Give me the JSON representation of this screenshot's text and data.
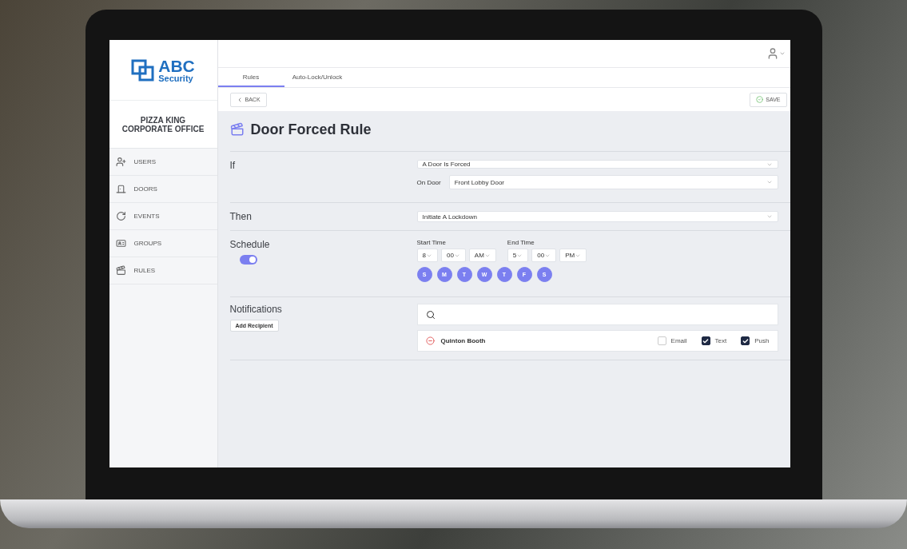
{
  "sidebar": {
    "logo": {
      "name": "ABC",
      "tagline": "Security"
    },
    "organization": "PIZZA KING CORPORATE OFFICE",
    "nav": [
      {
        "label": "USERS"
      },
      {
        "label": "DOORS"
      },
      {
        "label": "EVENTS"
      },
      {
        "label": "GROUPS"
      },
      {
        "label": "RULES"
      }
    ]
  },
  "tabs": [
    {
      "label": "Rules",
      "selected": true
    },
    {
      "label": "Auto-Lock/Unlock",
      "selected": false
    }
  ],
  "toolbar": {
    "back": "BACK",
    "save": "SAVE"
  },
  "title": "Door Forced Rule",
  "if": {
    "label": "If",
    "trigger": "A Door Is Forced",
    "door_label": "On Door",
    "door": "Front Lobby Door"
  },
  "then": {
    "label": "Then",
    "action": "Initiate A Lockdown"
  },
  "schedule": {
    "label": "Schedule",
    "enabled": true,
    "start_label": "Start Time",
    "start": [
      "8",
      "00",
      "AM"
    ],
    "end_label": "End Time",
    "end": [
      "5",
      "00",
      "PM"
    ],
    "days": [
      {
        "label": "S",
        "selected": true
      },
      {
        "label": "M",
        "selected": true
      },
      {
        "label": "T",
        "selected": true
      },
      {
        "label": "W",
        "selected": true
      },
      {
        "label": "T",
        "selected": true
      },
      {
        "label": "F",
        "selected": true
      },
      {
        "label": "S",
        "selected": true
      }
    ]
  },
  "notifications": {
    "label": "Notifications",
    "add_button": "Add Recipient",
    "recipients": [
      {
        "name": "Quinton Booth",
        "channels": [
          {
            "label": "Email",
            "checked": false
          },
          {
            "label": "Text",
            "checked": true
          },
          {
            "label": "Push",
            "checked": true
          }
        ]
      }
    ]
  }
}
